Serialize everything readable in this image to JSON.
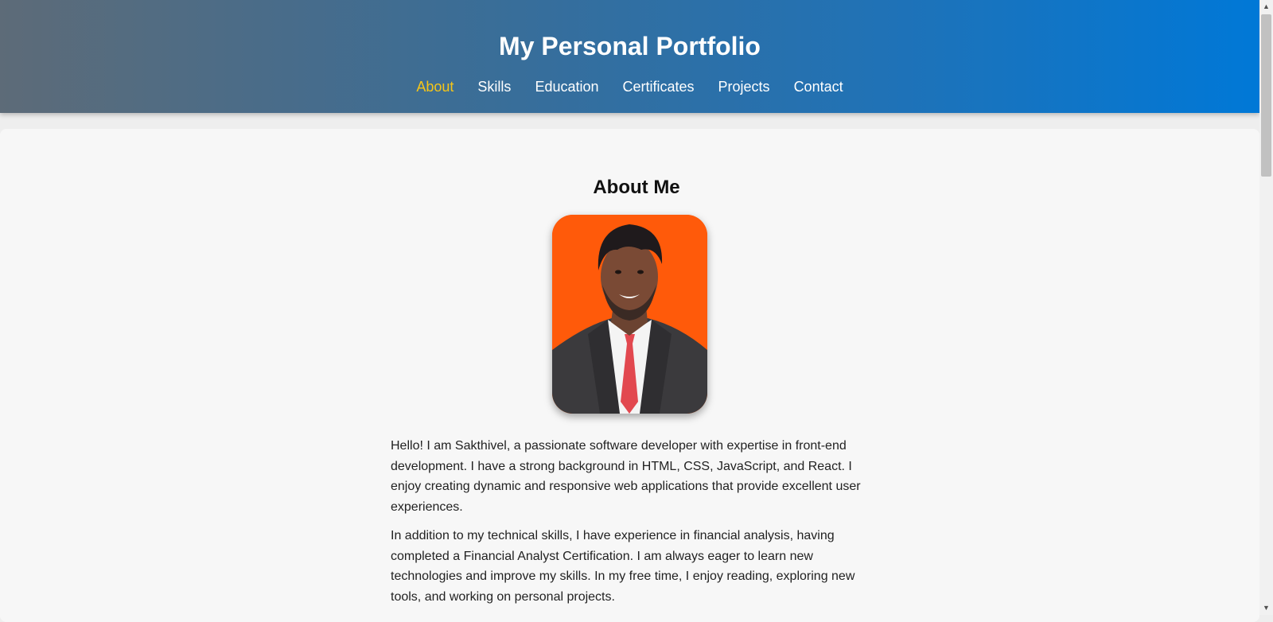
{
  "header": {
    "title": "My Personal Portfolio",
    "nav": [
      {
        "label": "About",
        "active": true
      },
      {
        "label": "Skills",
        "active": false
      },
      {
        "label": "Education",
        "active": false
      },
      {
        "label": "Certificates",
        "active": false
      },
      {
        "label": "Projects",
        "active": false
      },
      {
        "label": "Contact",
        "active": false
      }
    ]
  },
  "about": {
    "heading": "About Me",
    "photo_icon": "profile-photo",
    "paragraphs": [
      "Hello! I am Sakthivel, a passionate software developer with expertise in front-end development. I have a strong background in HTML, CSS, JavaScript, and React. I enjoy creating dynamic and responsive web applications that provide excellent user experiences.",
      "In addition to my technical skills, I have experience in financial analysis, having completed a Financial Analyst Certification. I am always eager to learn new technologies and improve my skills. In my free time, I enjoy reading, exploring new tools, and working on personal projects."
    ]
  },
  "colors": {
    "header_gradient_start": "#5d6b78",
    "header_gradient_end": "#0078d7",
    "nav_active": "#f5c518",
    "photo_background": "#ff5a0a"
  },
  "scrollbar": {
    "up_icon": "chevron-up-icon",
    "down_icon": "chevron-down-icon"
  }
}
